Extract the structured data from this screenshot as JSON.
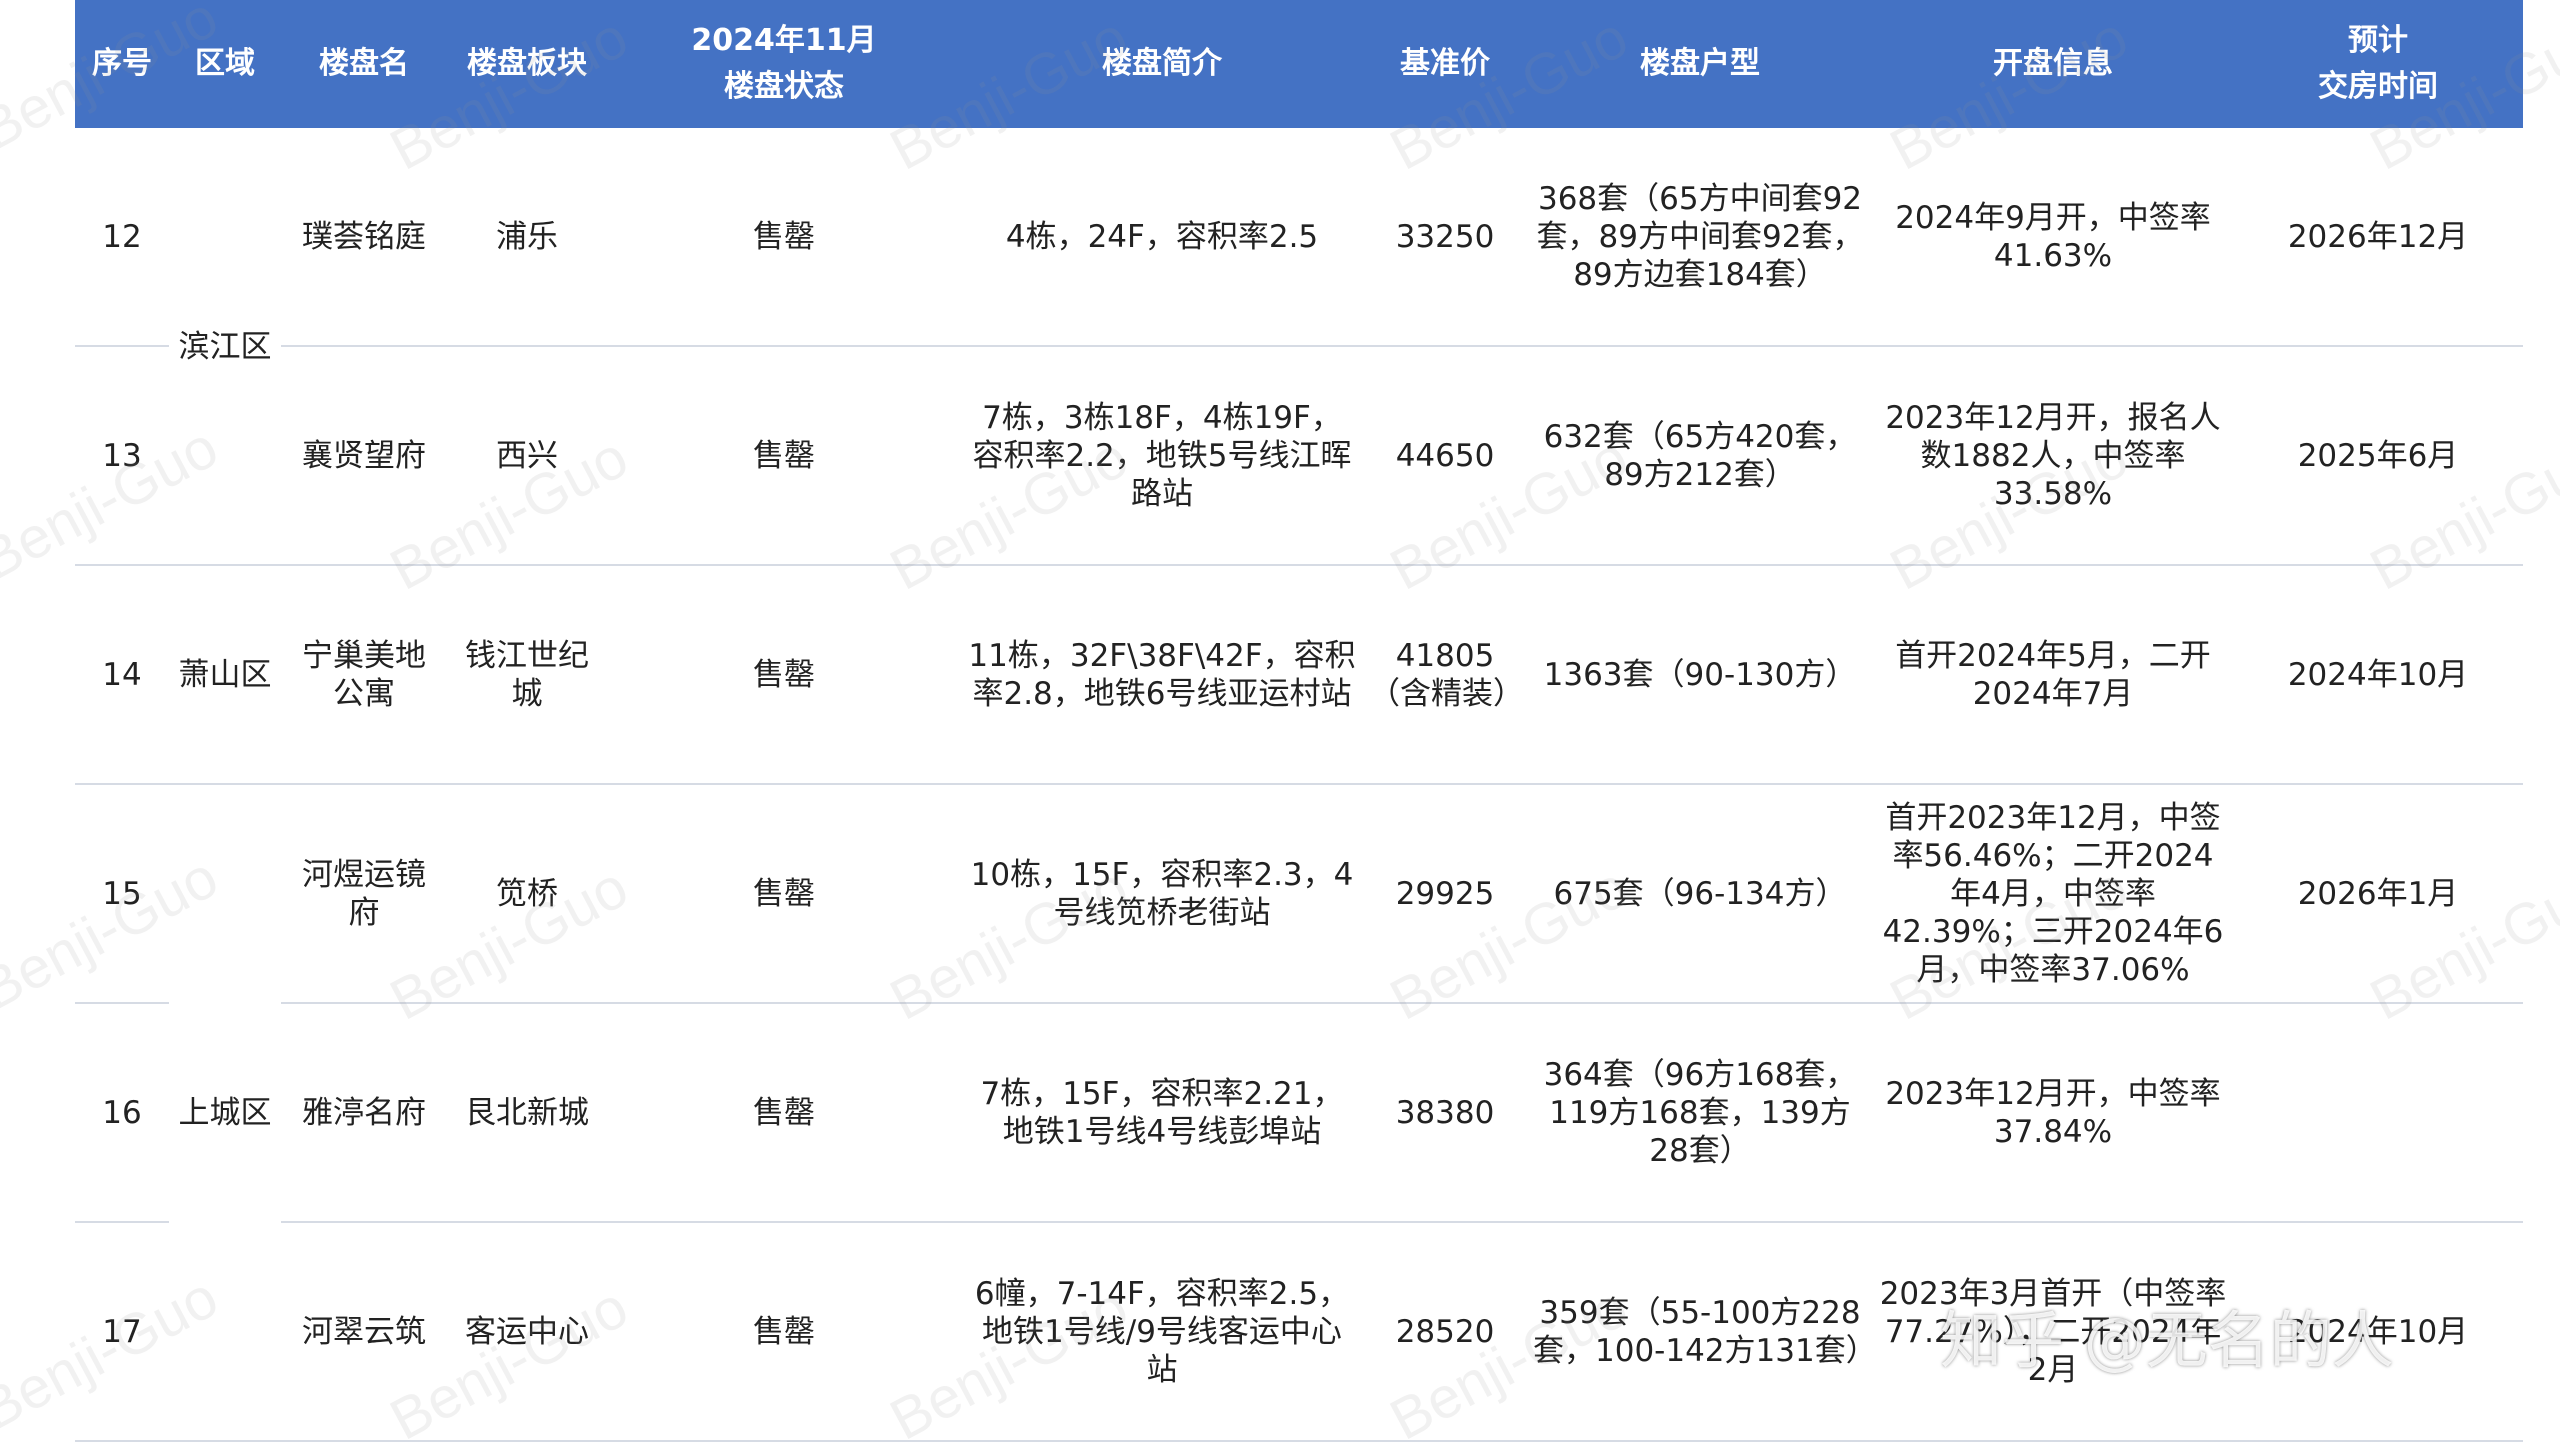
{
  "headers": {
    "no": "序号",
    "district": "区域",
    "name": "楼盘名",
    "block": "楼盘板块",
    "status_line1": "2024年11月",
    "status_line2": "楼盘状态",
    "intro": "楼盘简介",
    "price": "基准价",
    "units": "楼盘户型",
    "opening": "开盘信息",
    "delivery_line1": "预计",
    "delivery_line2": "交房时间"
  },
  "rows": [
    {
      "no": "12",
      "district": "",
      "name": "璞荟铭庭",
      "block": "浦乐",
      "status": "售罄",
      "intro": "4栋，24F，容积率2.5",
      "price": "33250",
      "units": "368套（65方中间套92套，89方中间套92套，89方边套184套）",
      "opening": "2024年9月开，中签率41.63%",
      "delivery": "2026年12月"
    },
    {
      "no": "13",
      "district": "",
      "name": "襄贤望府",
      "block": "西兴",
      "status": "售罄",
      "intro": "7栋，3栋18F，4栋19F，容积率2.2，地铁5号线江晖路站",
      "price": "44650",
      "units": "632套（65方420套，89方212套）",
      "opening": "2023年12月开，报名人数1882人，中签率33.58%",
      "delivery": "2025年6月"
    },
    {
      "no": "14",
      "district": "萧山区",
      "name": "宁巢美地公寓",
      "block": "钱江世纪城",
      "status": "售罄",
      "intro": "11栋，32F\\38F\\42F，容积率2.8，地铁6号线亚运村站",
      "price": "41805（含精装）",
      "units": "1363套（90-130方）",
      "opening": "首开2024年5月，二开2024年7月",
      "delivery": "2024年10月"
    },
    {
      "no": "15",
      "district": "",
      "name": "河煜运镜府",
      "block": "笕桥",
      "status": "售罄",
      "intro": "10栋，15F，容积率2.3，4号线笕桥老街站",
      "price": "29925",
      "units": "675套（96-134方）",
      "opening": "首开2023年12月，中签率56.46%；二开2024年4月，中签率42.39%；三开2024年6月，中签率37.06%",
      "delivery": "2026年1月"
    },
    {
      "no": "16",
      "district": "上城区",
      "name": "雅渟名府",
      "block": "艮北新城",
      "status": "售罄",
      "intro": "7栋，15F，容积率2.21，地铁1号线4号线彭埠站",
      "price": "38380",
      "units": "364套（96方168套，119方168套，139方28套）",
      "opening": "2023年12月开，中签率37.84%",
      "delivery": ""
    },
    {
      "no": "17",
      "district": "",
      "name": "河翠云筑",
      "block": "客运中心",
      "status": "售罄",
      "intro": "6幢，7-14F，容积率2.5，地铁1号线/9号线客运中心站",
      "price": "28520",
      "units": "359套（55-100方228套，100-142方131套）",
      "opening": "2023年3月首开（中签率77.27%），二开2024年2月",
      "delivery": "2024年10月"
    }
  ],
  "region_binhu": "滨江区",
  "watermark": "Benji-Guo",
  "zhihu_mark": "知乎 @无名的人"
}
